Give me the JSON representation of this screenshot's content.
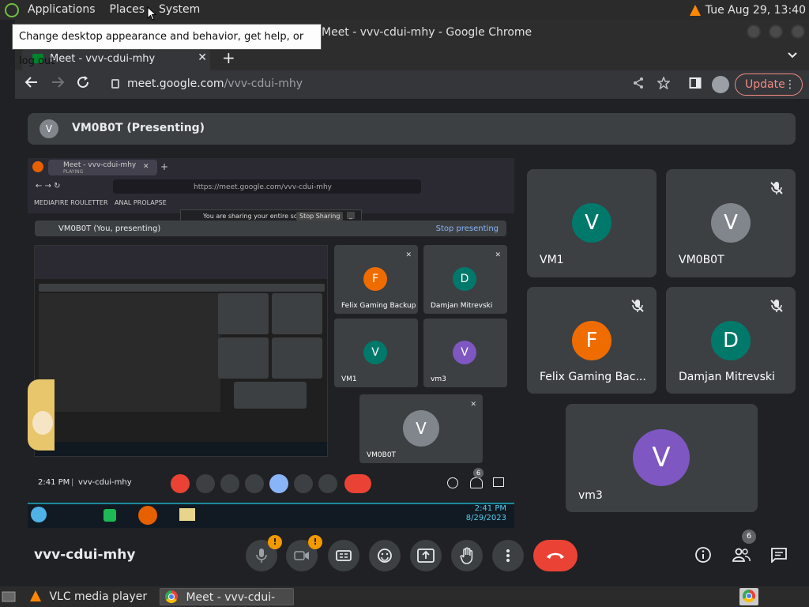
{
  "panel": {
    "menus": [
      "Applications",
      "Places",
      "System"
    ],
    "clock": "Tue Aug 29, 13:40",
    "tooltip": "Change desktop appearance and behavior, get help, or log out"
  },
  "window": {
    "title": "Meet - vvv-cdui-mhy - Google Chrome"
  },
  "tab": {
    "label": "Meet - vvv-cdui-mhy",
    "close": "✕",
    "new": "+"
  },
  "toolbar": {
    "url_host": "meet.google.com",
    "url_path": "/vvv-cdui-mhy",
    "update_label": "Update"
  },
  "meet": {
    "presenting_avatar": "V",
    "presenting_label": "VM0B0T (Presenting)",
    "meeting_code": "vvv-cdui-mhy",
    "participant_count": "6",
    "badge": "!",
    "tiles": [
      {
        "name": "VM1",
        "initial": "V",
        "color": "#00796b",
        "muted": false
      },
      {
        "name": "VM0B0T",
        "initial": "V",
        "color": "#80868b",
        "muted": true
      },
      {
        "name": "Felix Gaming Bac...",
        "initial": "F",
        "color": "#ef6c00",
        "muted": true
      },
      {
        "name": "Damjan Mitrevski",
        "initial": "D",
        "color": "#00796b",
        "muted": true
      },
      {
        "name": "vm3",
        "initial": "V",
        "color": "#7e57c2",
        "muted": false
      }
    ]
  },
  "shared_screen": {
    "tab_label": "Meet - vvv-cdui-mhy",
    "tab_sub": "PLAYING",
    "url": "https://meet.google.com/vvv-cdui-mhy",
    "bookmark1": "MEDIAFIRE ROULETTER",
    "bookmark2": "ANAL PROLAPSE",
    "share_notice": "You are sharing your entire screen.",
    "stop_sharing": "Stop Sharing",
    "hide": "_",
    "presenting_label": "VM0B0T (You, presenting)",
    "stop_presenting": "Stop presenting",
    "time": "2:41 PM",
    "code": "vvv-cdui-mhy",
    "count": "6",
    "clock_time": "2:41 PM",
    "clock_date": "8/29/2023",
    "tiles": [
      {
        "name": "Felix Gaming Backup",
        "initial": "F",
        "color": "#ef6c00"
      },
      {
        "name": "Damjan Mitrevski",
        "initial": "D",
        "color": "#00796b"
      },
      {
        "name": "VM1",
        "initial": "V",
        "color": "#00796b"
      },
      {
        "name": "vm3",
        "initial": "V",
        "color": "#7e57c2"
      },
      {
        "name": "VM0B0T",
        "initial": "V",
        "color": "#80868b"
      }
    ]
  },
  "taskbar": {
    "vlc_label": "VLC media player",
    "chrome_label": "Meet - vvv-cdui-mhy..."
  }
}
